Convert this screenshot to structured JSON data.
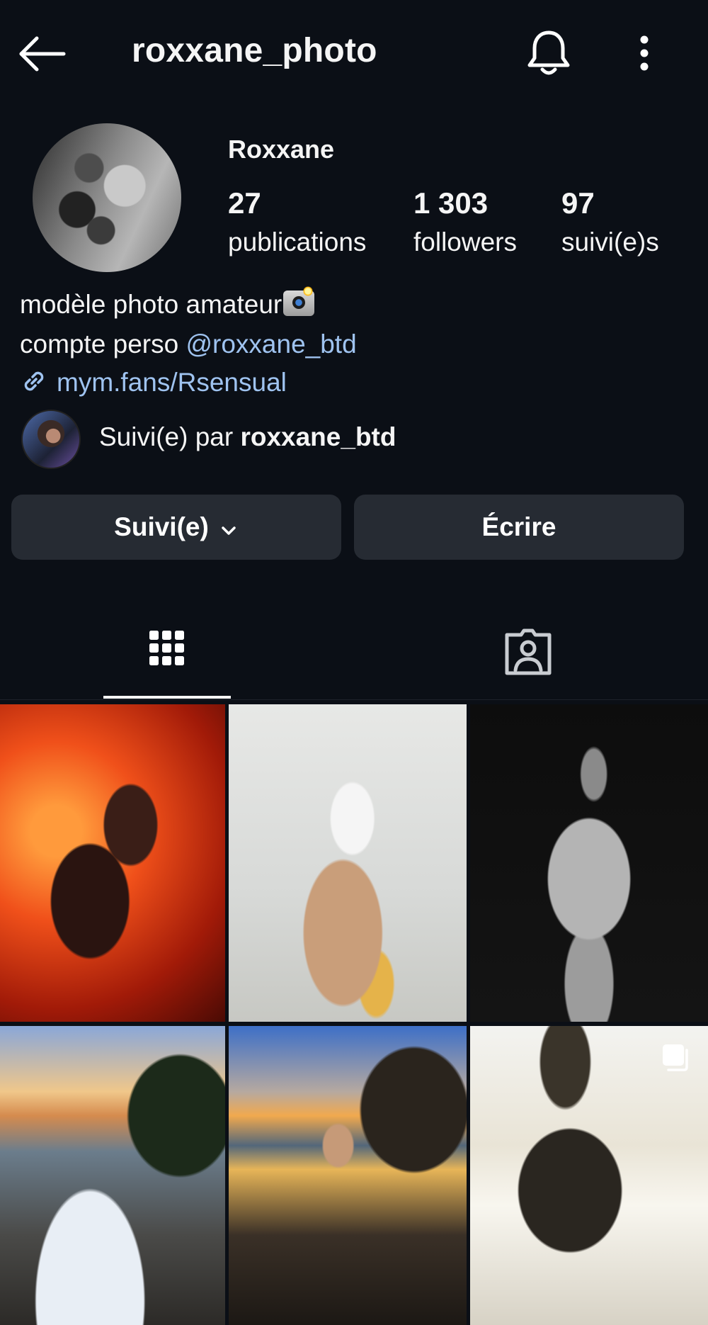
{
  "header": {
    "username": "roxxane_photo"
  },
  "profile": {
    "display_name": "Roxxane",
    "stats": {
      "posts_count": "27",
      "posts_label": "publications",
      "followers_count": "1 303",
      "followers_label": "followers",
      "following_count": "97",
      "following_label": "suivi(e)s"
    },
    "bio": {
      "line1": "modèle photo amateur",
      "line2_prefix": "compte perso ",
      "line2_mention": "@roxxane_btd",
      "link": "mym.fans/Rsensual"
    },
    "followed_by": {
      "prefix": "Suivi(e) par ",
      "username": "roxxane_btd"
    }
  },
  "actions": {
    "follow_label": "Suivi(e)",
    "message_label": "Écrire"
  },
  "tabs": [
    {
      "name": "posts-grid",
      "icon": "grid-icon",
      "active": true
    },
    {
      "name": "tagged",
      "icon": "tagged-person-icon",
      "active": false
    }
  ],
  "colors": {
    "background": "#0b0f16",
    "button": "#262b33",
    "link": "#9fc3f0",
    "text": "#f5f5f5"
  }
}
